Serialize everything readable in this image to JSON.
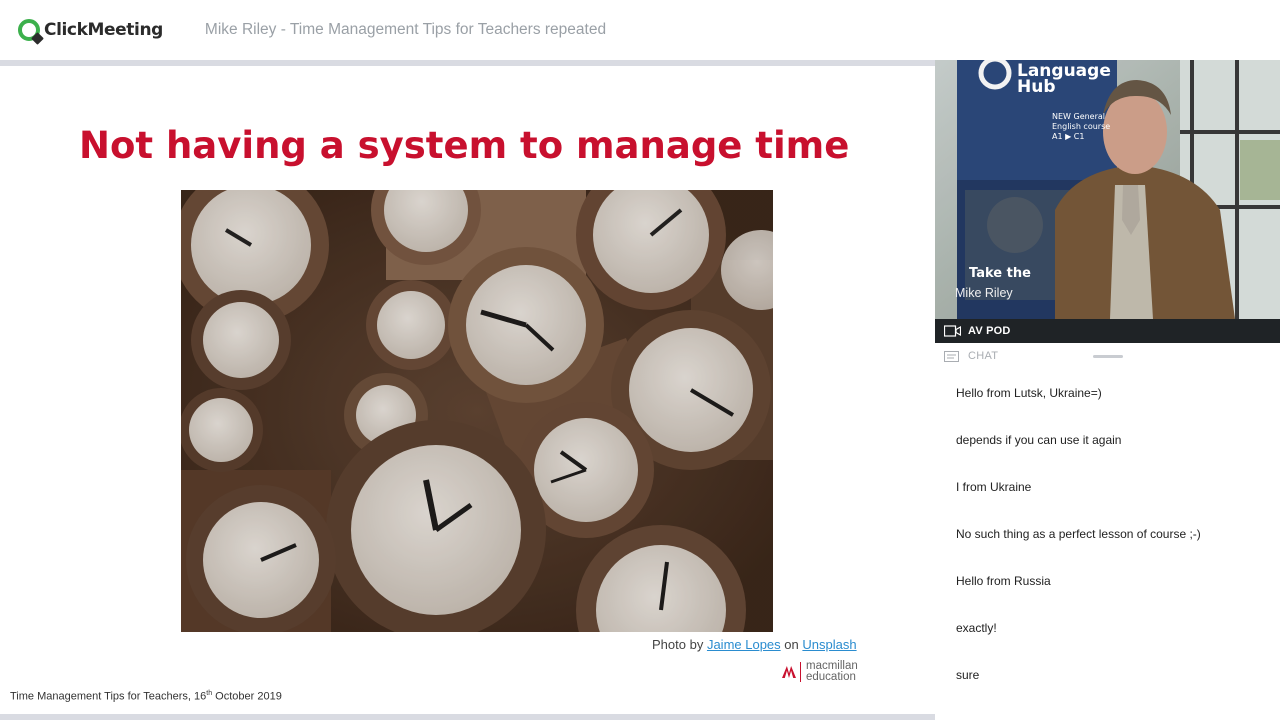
{
  "app": {
    "logo_text": "ClickMeeting",
    "meeting_title": "Mike Riley - Time Management Tips for Teachers repeated"
  },
  "slide": {
    "heading": "Not having a system to manage time",
    "photo_credit": {
      "prefix": "Photo by",
      "author": "Jaime Lopes",
      "on": "on",
      "site": "Unsplash"
    },
    "brand": {
      "line1": "macmillan",
      "line2": "education"
    },
    "footer": {
      "text_before": "Time Management Tips for Teachers, 16",
      "superscript": "th",
      "text_after": " October 2019"
    }
  },
  "av_pod": {
    "presenter_name": "Mike Riley",
    "label": "AV POD",
    "poster_text": {
      "line1": "Language",
      "line2": "Hub",
      "small1": "NEW General",
      "small2": "English course",
      "small3": "A1 ▶ C1",
      "tagline": "Take the"
    }
  },
  "chat": {
    "label": "CHAT",
    "messages": [
      "Hello from Lutsk, Ukraine=)",
      "depends if you can use it again",
      "I from Ukraine",
      "No such thing as a perfect lesson of course ;-)",
      "Hello from Russia",
      "exactly!",
      "sure"
    ]
  },
  "colors": {
    "heading_red": "#c8102e",
    "link_blue": "#2a8ccf",
    "logo_green": "#3cb04c",
    "av_bar": "#1f2326"
  }
}
